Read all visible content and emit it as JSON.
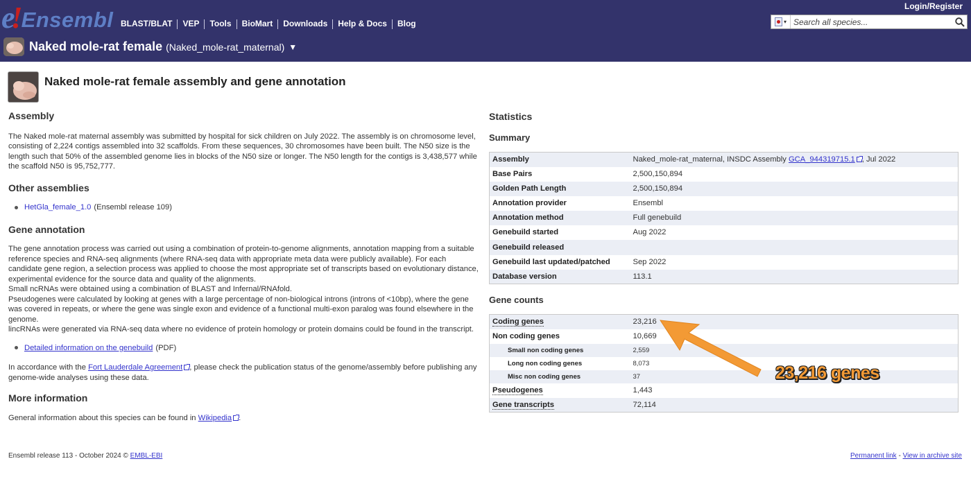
{
  "masthead": {
    "logo_e": "e",
    "logo_bang": "!",
    "logo_text": "Ensembl",
    "nav": [
      "BLAST/BLAT",
      "VEP",
      "Tools",
      "BioMart",
      "Downloads",
      "Help & Docs",
      "Blog"
    ],
    "login_label": "Login/Register",
    "search_placeholder": "Search all species...",
    "species_name": "Naked mole-rat female",
    "species_assembly": "(Naked_mole-rat_maternal)",
    "species_caret": "▼"
  },
  "page": {
    "title": "Naked mole-rat female assembly and gene annotation"
  },
  "assembly": {
    "heading": "Assembly",
    "text": "The Naked mole-rat maternal assembly was submitted by hospital for sick children on July 2022. The assembly is on chromosome level, consisting of 2,224 contigs assembled into 32 scaffolds. From these sequences, 30 chromosomes have been built. The N50 size is the length such that 50% of the assembled genome lies in blocks of the N50 size or longer. The N50 length for the contigs is 3,438,577 while the scaffold N50 is 95,752,777."
  },
  "other_assemblies": {
    "heading": "Other assemblies",
    "link": "HetGla_female_1.0",
    "note": "(Ensembl release 109)"
  },
  "gene_annotation": {
    "heading": "Gene annotation",
    "lines": [
      "The gene annotation process was carried out using a combination of protein-to-genome alignments, annotation mapping from a suitable reference species and RNA-seq alignments (where RNA-seq data with appropriate meta data were publicly available). For each candidate gene region, a selection process was applied to choose the most appropriate set of transcripts based on evolutionary distance, experimental evidence for the source data and quality of the alignments.",
      "Small ncRNAs were obtained using a combination of BLAST and Infernal/RNAfold.",
      "Pseudogenes were calculated by looking at genes with a large percentage of non-biological introns (introns of <10bp), where the gene was covered in repeats, or where the gene was single exon and evidence of a functional multi-exon paralog was found elsewhere in the genome.",
      "lincRNAs were generated via RNA-seq data where no evidence of protein homology or protein domains could be found in the transcript."
    ],
    "detail_link": "Detailed information on the genebuild",
    "detail_note": "(PDF)",
    "fla_prefix": "In accordance with the ",
    "fla_link": "Fort Lauderdale Agreement",
    "fla_suffix": ", please check the publication status of the genome/assembly before publishing any genome-wide analyses using these data."
  },
  "more_info": {
    "heading": "More information",
    "prefix": "General information about this species can be found in ",
    "link": "Wikipedia",
    "suffix": "."
  },
  "statistics": {
    "heading": "Statistics",
    "summary_heading": "Summary",
    "summary_rows": [
      {
        "label": "Assembly",
        "value_prefix": "Naked_mole-rat_maternal, INSDC Assembly ",
        "value_link": "GCA_944319715.1",
        "value_suffix": ", Jul 2022"
      },
      {
        "label": "Base Pairs",
        "value": "2,500,150,894"
      },
      {
        "label": "Golden Path Length",
        "value": "2,500,150,894"
      },
      {
        "label": "Annotation provider",
        "value": "Ensembl"
      },
      {
        "label": "Annotation method",
        "value": "Full genebuild"
      },
      {
        "label": "Genebuild started",
        "value": "Aug 2022"
      },
      {
        "label": "Genebuild released",
        "value": ""
      },
      {
        "label": "Genebuild last updated/patched",
        "value": "Sep 2022"
      },
      {
        "label": "Database version",
        "value": "113.1"
      }
    ],
    "gene_counts_heading": "Gene counts",
    "gene_rows": [
      {
        "label": "Coding genes",
        "value": "23,216"
      },
      {
        "label": "Non coding genes",
        "value": "10,669"
      },
      {
        "label": "Small non coding genes",
        "value": "2,559"
      },
      {
        "label": "Long non coding genes",
        "value": "8,073"
      },
      {
        "label": "Misc non coding genes",
        "value": "37"
      },
      {
        "label": "Pseudogenes",
        "value": "1,443"
      },
      {
        "label": "Gene transcripts",
        "value": "72,114"
      }
    ]
  },
  "annotation": {
    "label": "23,216 genes",
    "color": "#f39a35"
  },
  "footer": {
    "left_text": "Ensembl release 113 - October 2024 © ",
    "left_link": "EMBL-EBI",
    "permanent_link": "Permanent link",
    "separator": " - ",
    "archive_link": "View in archive site"
  }
}
